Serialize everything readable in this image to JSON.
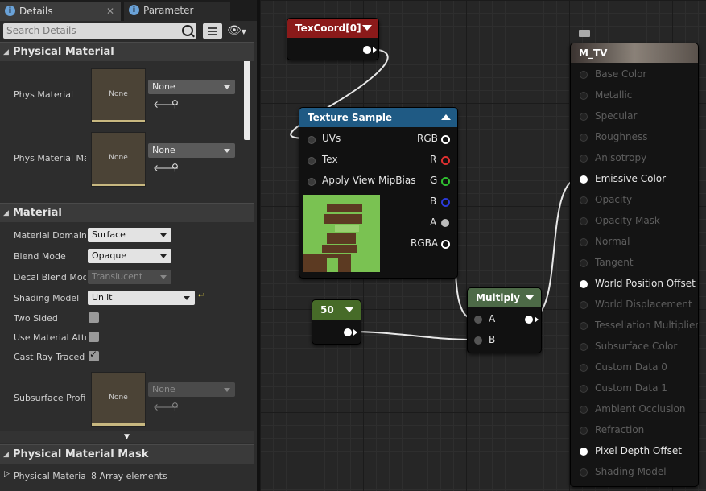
{
  "tabs": [
    {
      "label": "Details",
      "icon": "info-icon"
    },
    {
      "label": "Parameter Defaults",
      "icon": "info-icon"
    }
  ],
  "search": {
    "placeholder": "Search Details"
  },
  "categories": {
    "physical_material": "Physical Material",
    "material": "Material",
    "physical_material_mask": "Physical Material Mask"
  },
  "phys": {
    "phys_material_label": "Phys Material",
    "phys_material_thumb": "None",
    "phys_material_value": "None",
    "phys_material_map_label": "Phys Material Map",
    "phys_material_map_thumb": "None",
    "phys_material_map_value": "None"
  },
  "material": {
    "domain_label": "Material Domain",
    "domain_value": "Surface",
    "blend_label": "Blend Mode",
    "blend_value": "Opaque",
    "decal_label": "Decal Blend Mode",
    "decal_value": "Translucent",
    "shading_label": "Shading Model",
    "shading_value": "Unlit",
    "two_sided_label": "Two Sided",
    "two_sided_checked": false,
    "use_attr_label": "Use Material Attributes",
    "use_attr_checked": false,
    "cast_ray_label": "Cast Ray Traced Shadows",
    "cast_ray_checked": true,
    "subsurface_label": "Subsurface Profile",
    "subsurface_thumb": "None",
    "subsurface_value": "None"
  },
  "mask": {
    "label": "Physical Material",
    "value": "8 Array elements"
  },
  "nodes": {
    "texcoord": {
      "title": "TexCoord[0]"
    },
    "texture_sample": {
      "title": "Texture Sample",
      "inputs": [
        "UVs",
        "Tex",
        "Apply View MipBias"
      ],
      "outputs": [
        "RGB",
        "R",
        "G",
        "B",
        "A",
        "RGBA"
      ]
    },
    "constant": {
      "title": "50"
    },
    "multiply": {
      "title": "Multiply",
      "inputs": [
        "A",
        "B"
      ]
    },
    "result": {
      "title": "M_TV",
      "pins": [
        "Base Color",
        "Metallic",
        "Specular",
        "Roughness",
        "Anisotropy",
        "Emissive Color",
        "Opacity",
        "Opacity Mask",
        "Normal",
        "Tangent",
        "World Position Offset",
        "World Displacement",
        "Tessellation Multiplier",
        "Subsurface Color",
        "Custom Data 0",
        "Custom Data 1",
        "Ambient Occlusion",
        "Refraction",
        "Pixel Depth Offset",
        "Shading Model"
      ],
      "active_pins": [
        "Emissive Color",
        "World Position Offset",
        "Pixel Depth Offset"
      ]
    }
  },
  "colors": {
    "texcoord_header": "#8b1a1a",
    "texture_header": "#1f5a84",
    "constant_header": "#466b28",
    "multiply_header": "#4d6a47",
    "result_header": "#6b6158",
    "pin_r": "#e03030",
    "pin_g": "#30c030",
    "pin_b": "#2a3ad8"
  }
}
